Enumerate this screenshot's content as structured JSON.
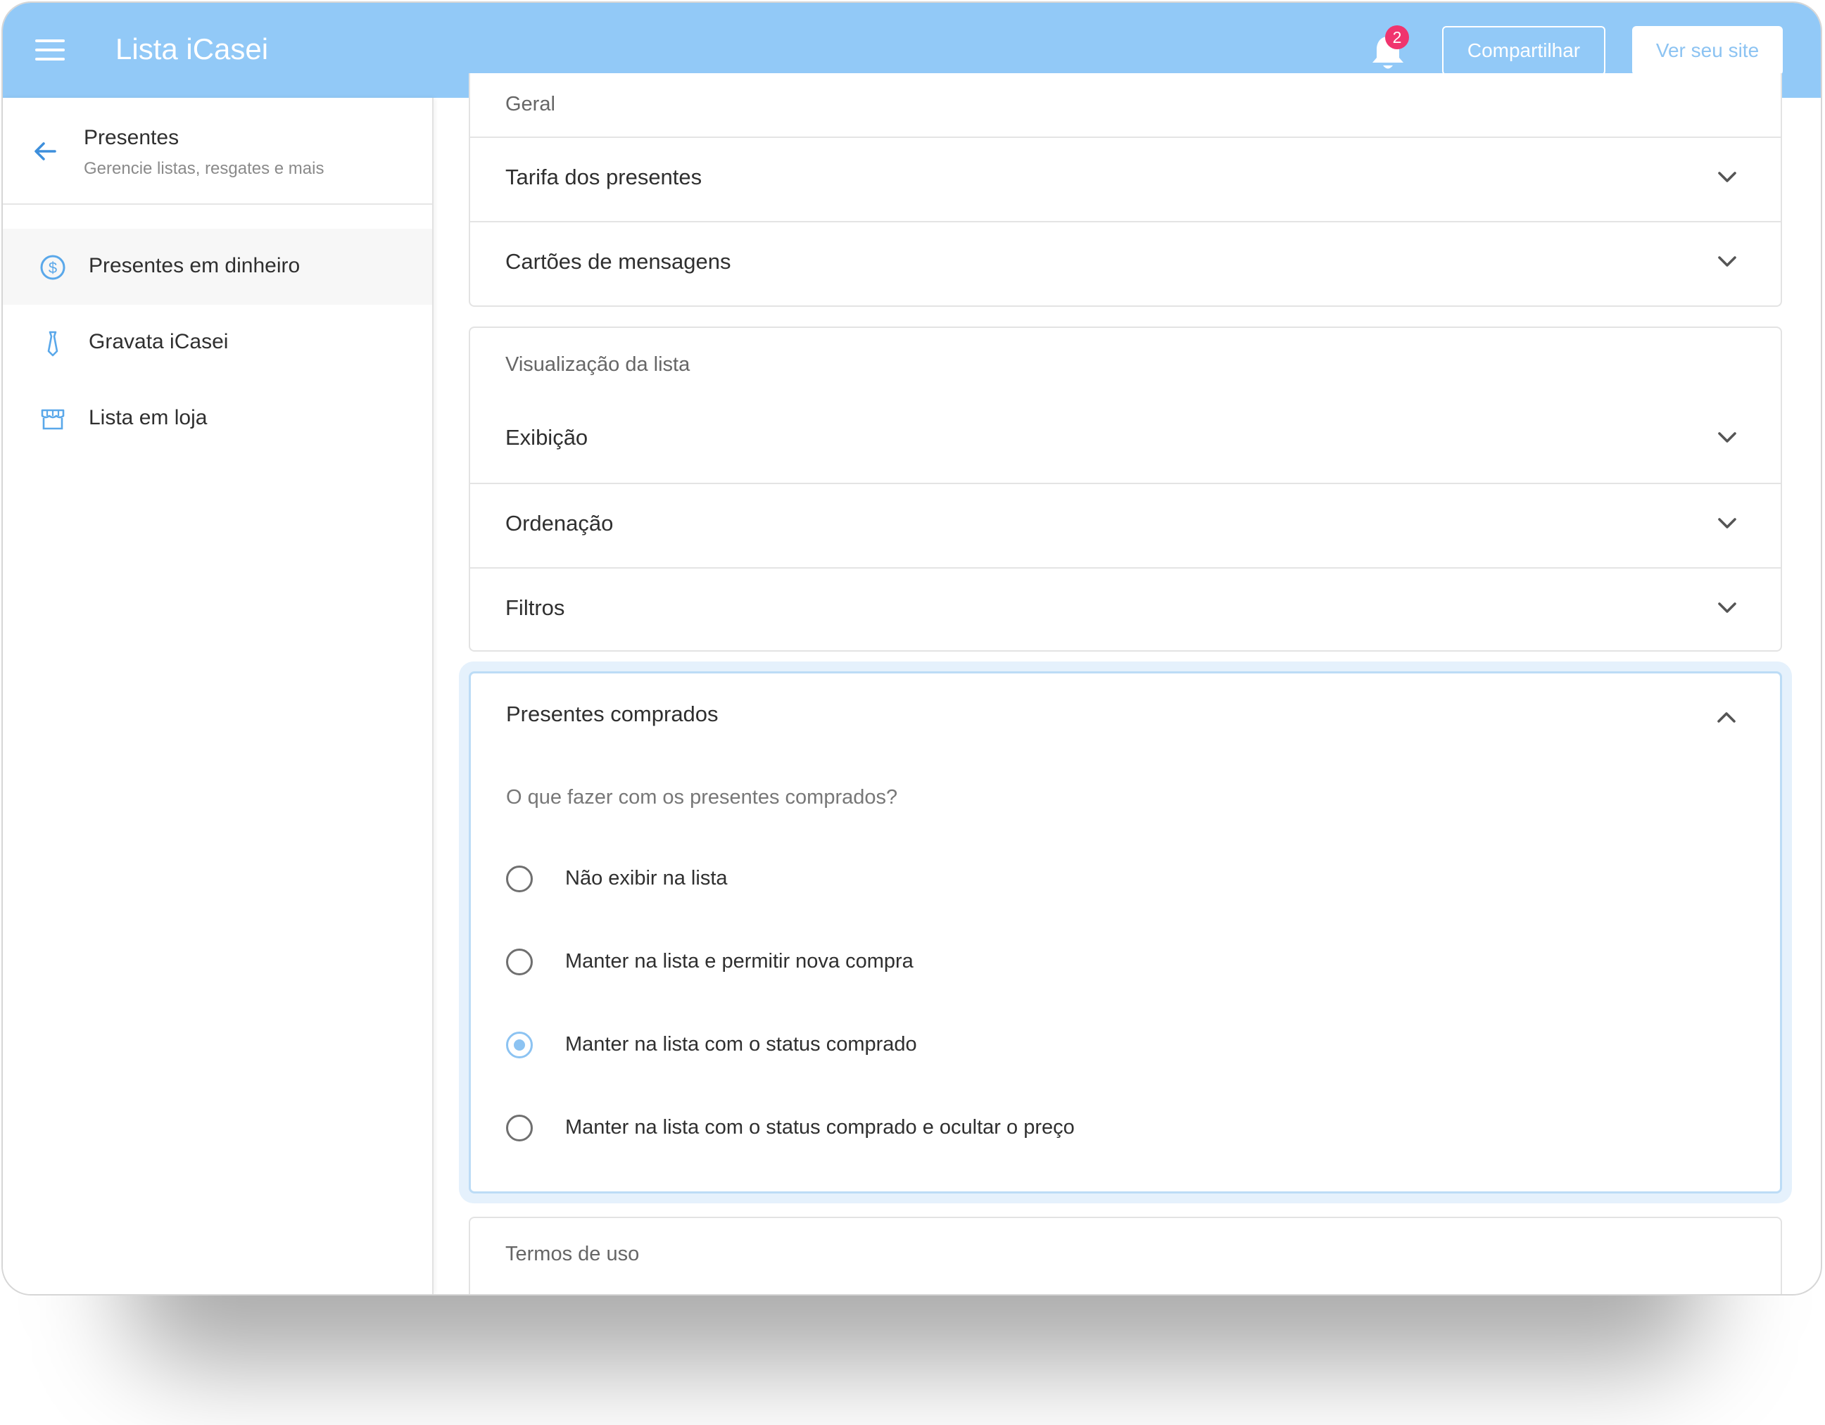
{
  "topbar": {
    "title": "Lista iCasei",
    "notification_count": "2",
    "share_label": "Compartilhar",
    "view_site_label": "Ver seu site",
    "bg_color": "#92c9f7"
  },
  "sidebar": {
    "title": "Presentes",
    "subtitle": "Gerencie listas, resgates e mais",
    "items": [
      {
        "label": "Presentes em dinheiro",
        "icon": "dollar-circle-icon",
        "active": true
      },
      {
        "label": "Gravata iCasei",
        "icon": "tie-icon",
        "active": false
      },
      {
        "label": "Lista em loja",
        "icon": "store-icon",
        "active": false
      }
    ]
  },
  "main": {
    "section_geral": {
      "header": "Geral",
      "rows": [
        "Tarifa dos presentes",
        "Cartões de mensagens"
      ]
    },
    "section_visualizacao": {
      "header": "Visualização da lista",
      "rows": [
        "Exibição",
        "Ordenação",
        "Filtros"
      ]
    },
    "section_comprados": {
      "title": "Presentes comprados",
      "question": "O que fazer com os presentes comprados?",
      "options": [
        {
          "label": "Não exibir na lista",
          "selected": false
        },
        {
          "label": "Manter na lista e permitir nova compra",
          "selected": false
        },
        {
          "label": "Manter na lista com o status comprado",
          "selected": true
        },
        {
          "label": "Manter na lista com o status comprado e ocultar o preço",
          "selected": false
        }
      ]
    },
    "section_termos": {
      "header": "Termos de uso"
    }
  },
  "colors": {
    "accent": "#8cc3f2",
    "badge": "#f0346e"
  }
}
